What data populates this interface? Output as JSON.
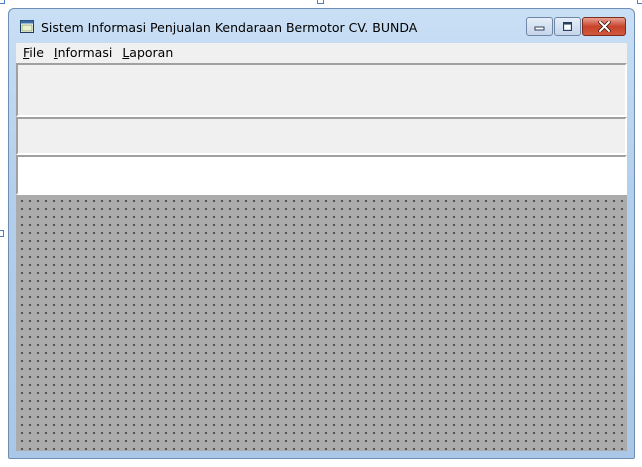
{
  "window": {
    "title": "Sistem Informasi Penjualan Kendaraan Bermotor CV. BUNDA",
    "icon": "app-window-icon",
    "controls": [
      "minimize-icon",
      "maximize-icon",
      "close-icon"
    ]
  },
  "menu": {
    "items": [
      {
        "accel": "F",
        "rest": "ile"
      },
      {
        "accel": "I",
        "rest": "nformasi"
      },
      {
        "accel": "L",
        "rest": "aporan"
      }
    ]
  },
  "colors": {
    "mdi_background": "#ababab",
    "grid_dots": "#000000",
    "close_button": "#c7432a"
  }
}
